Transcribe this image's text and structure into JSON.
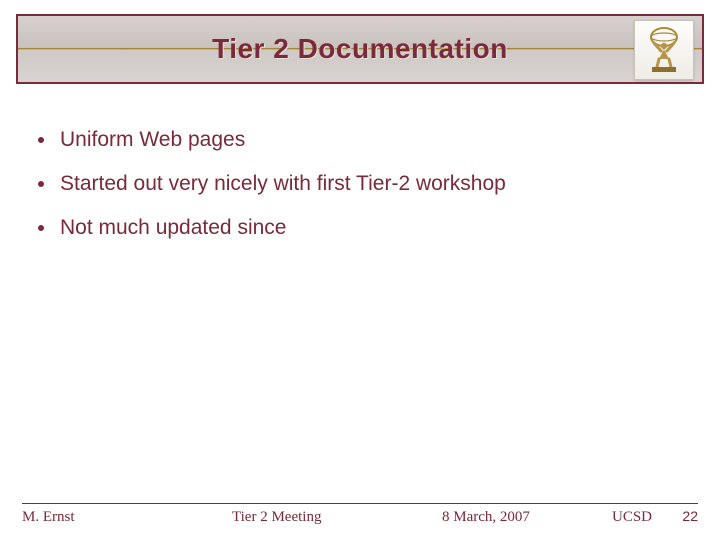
{
  "title": "Tier 2 Documentation",
  "logo_name": "atlas-statue-icon",
  "bullets": [
    "Uniform Web pages",
    "Started out very nicely with first Tier-2 workshop",
    "Not much updated since"
  ],
  "footer": {
    "author": "M. Ernst",
    "event": "Tier 2 Meeting",
    "date": "8 March, 2007",
    "location": "UCSD",
    "page": "22"
  },
  "colors": {
    "accent": "#7a2a3a"
  }
}
